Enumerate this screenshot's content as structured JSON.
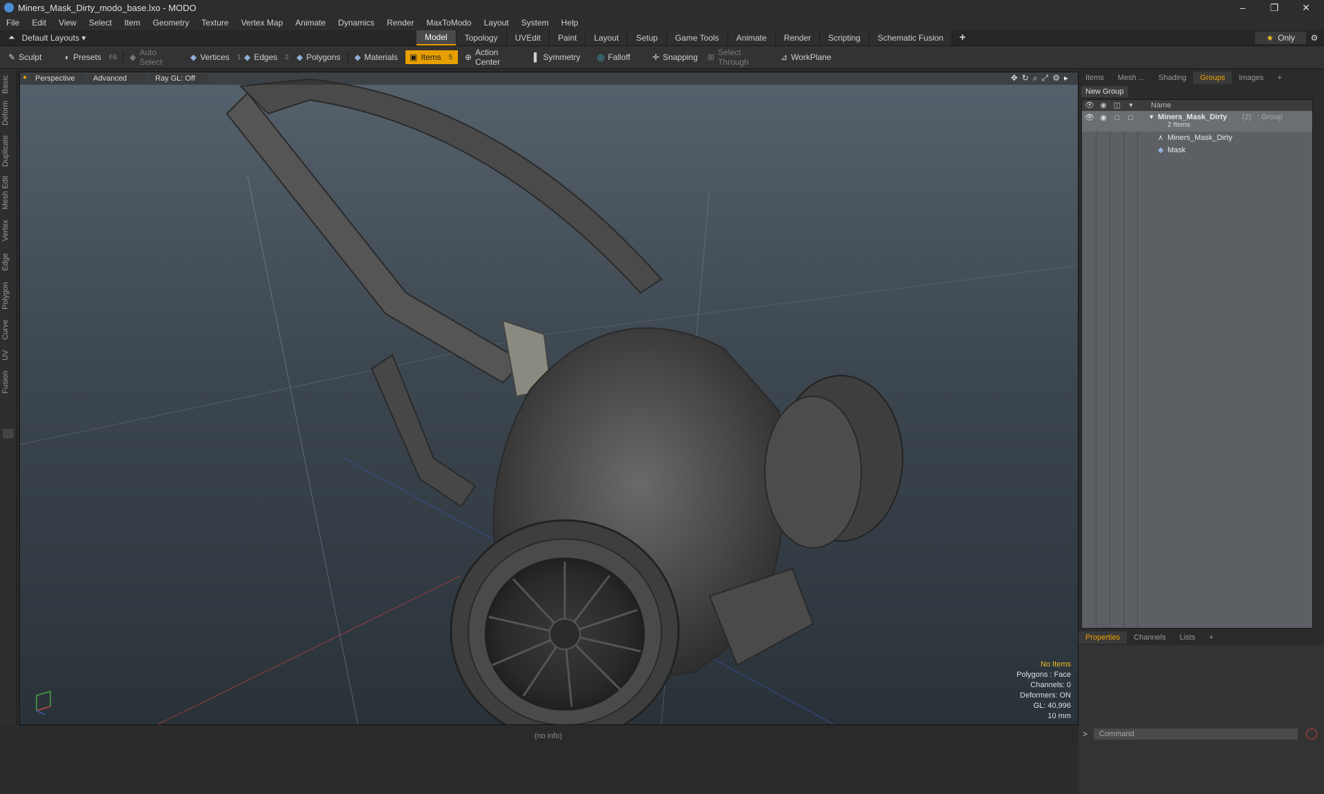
{
  "window": {
    "title": "Miners_Mask_Dirty_modo_base.lxo - MODO",
    "minimize": "–",
    "restore": "❐",
    "close": "✕"
  },
  "menu": [
    "File",
    "Edit",
    "View",
    "Select",
    "Item",
    "Geometry",
    "Texture",
    "Vertex Map",
    "Animate",
    "Dynamics",
    "Render",
    "MaxToModo",
    "Layout",
    "System",
    "Help"
  ],
  "layout_selector": "Default Layouts ▾",
  "mode_tabs": [
    "Model",
    "Topology",
    "UVEdit",
    "Paint",
    "Layout",
    "Setup",
    "Game Tools",
    "Animate",
    "Render",
    "Scripting",
    "Schematic Fusion"
  ],
  "active_mode_tab": "Model",
  "add_tab": "+",
  "only_button": "Only",
  "toolbar": {
    "sculpt": "Sculpt",
    "presets": "Presets",
    "presets_key": "F6",
    "auto_select": "Auto Select",
    "vertices": "Vertices",
    "vertices_key": "1",
    "edges": "Edges",
    "edges_key": "2",
    "polygons": "Polygons",
    "materials": "Materials",
    "items": "Items",
    "items_key": "5",
    "action_center": "Action Center",
    "symmetry": "Symmetry",
    "falloff": "Falloff",
    "snapping": "Snapping",
    "select_through": "Select Through",
    "workplane": "WorkPlane"
  },
  "left_tabs": [
    "Basic",
    "Deform",
    "Duplicate",
    "Mesh Edit",
    "Vertex",
    "Edge",
    "Polygon",
    "Curve",
    "UV",
    "Fusion"
  ],
  "viewport": {
    "perspective": "Perspective",
    "advanced": "Advanced",
    "ray_gl": "Ray GL: Off",
    "info": {
      "no_items": "No Items",
      "polygons": "Polygons : Face",
      "channels": "Channels: 0",
      "deformers": "Deformers: ON",
      "gl": "GL: 40,996",
      "scale": "10 mm"
    }
  },
  "status": "(no info)",
  "right_panel": {
    "tabs": [
      "Items",
      "Mesh ...",
      "Shading",
      "Groups",
      "Images",
      "+"
    ],
    "active_tab": "Groups",
    "new_group": "New Group",
    "name_header": "Name",
    "group": {
      "name": "Miners_Mask_Dirty",
      "count": "(2)",
      "type": ": Group",
      "sub": "2 Items"
    },
    "children": [
      "Miners_Mask_Dirty",
      "Mask"
    ]
  },
  "bottom_panel": {
    "tabs": [
      "Properties",
      "Channels",
      "Lists",
      "+"
    ],
    "active_tab": "Properties",
    "command_placeholder": "Command",
    "prompt": ">"
  },
  "colors": {
    "accent": "#e8a000",
    "viewport_top": "#55616c",
    "viewport_bottom": "#2a3239"
  }
}
